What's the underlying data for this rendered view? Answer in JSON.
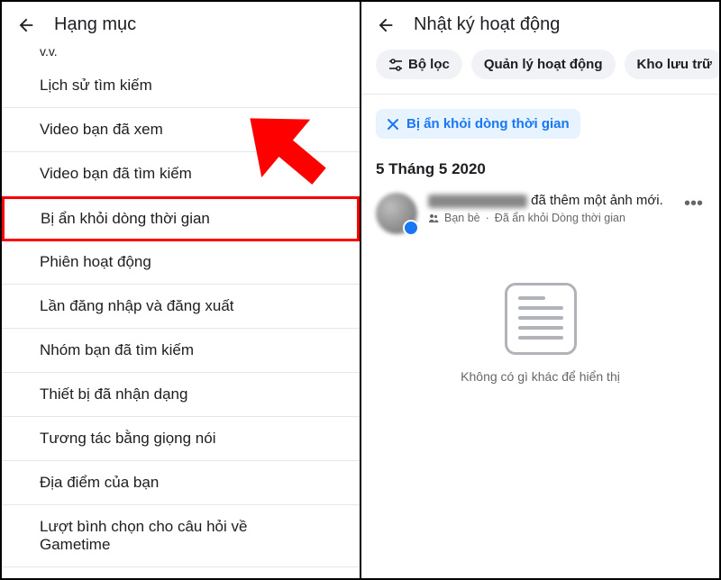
{
  "left": {
    "title": "Hạng mục",
    "prelude": "v.v.",
    "items": [
      "Lịch sử tìm kiếm",
      "Video bạn đã xem",
      "Video bạn đã tìm kiếm",
      "Bị ẩn khỏi dòng thời gian",
      "Phiên hoạt động",
      "Lần đăng nhập và đăng xuất",
      "Nhóm bạn đã tìm kiếm",
      "Thiết bị đã nhận dạng",
      "Tương tác bằng giọng nói",
      "Địa điểm của bạn",
      "Lượt bình chọn cho câu hỏi về Gametime"
    ],
    "highlight_index": 3
  },
  "right": {
    "title": "Nhật ký hoạt động",
    "chips": {
      "filter": "Bộ lọc",
      "manage": "Quản lý hoạt động",
      "archive": "Kho lưu trữ"
    },
    "applied_filter": "Bị ẩn khỏi dòng thời gian",
    "date_heading": "5 Tháng 5 2020",
    "feed": {
      "action_suffix": " đã thêm một ảnh mới.",
      "audience": "Bạn bè",
      "meta_separator": " · ",
      "hidden_label": "Đã ẩn khỏi Dòng thời gian"
    },
    "empty_text": "Không có gì khác để hiển thị"
  }
}
